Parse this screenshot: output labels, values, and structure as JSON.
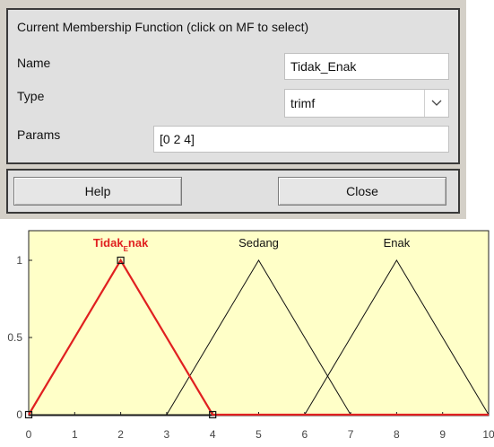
{
  "panel": {
    "header": "Current Membership Function (click on MF to select)",
    "name_label": "Name",
    "name_value": "Tidak_Enak",
    "type_label": "Type",
    "type_value": "trimf",
    "params_label": "Params",
    "params_value": "[0 2 4]",
    "help_label": "Help",
    "close_label": "Close"
  },
  "chart_data": {
    "type": "line",
    "xlim": [
      0,
      10
    ],
    "ylim": [
      0,
      1
    ],
    "x_ticks": [
      "0",
      "1",
      "2",
      "3",
      "4",
      "5",
      "6",
      "7",
      "8",
      "9",
      "10"
    ],
    "y_ticks": [
      "0",
      "0.5",
      "1"
    ],
    "selected_color": "#e02020",
    "line_color": "#111111",
    "background_color": "#ffffc8",
    "series": [
      {
        "name": "Tidak_Enak",
        "label_main": "Tidak",
        "label_sub": "E",
        "label_rest": "nak",
        "params": [
          0,
          2,
          4
        ],
        "selected": true
      },
      {
        "name": "Sedang",
        "params": [
          3,
          5,
          7
        ],
        "selected": false
      },
      {
        "name": "Enak",
        "params": [
          6,
          8,
          10
        ],
        "selected": false
      }
    ]
  }
}
